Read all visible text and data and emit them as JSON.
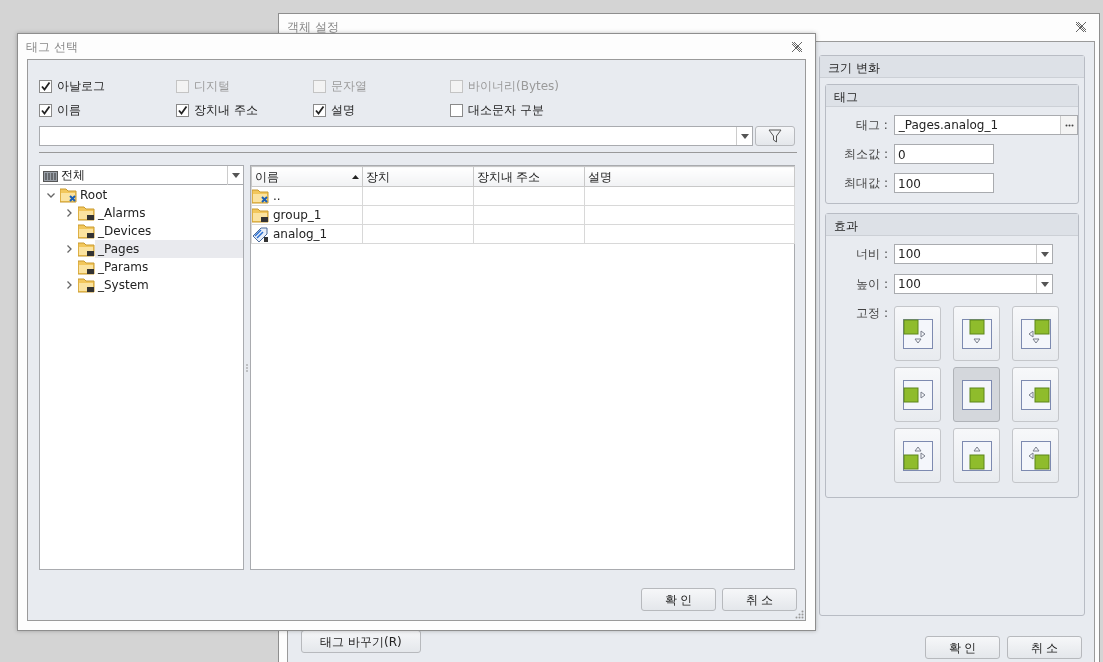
{
  "back_window": {
    "title": "객체 설정",
    "replace_button": "태그 바꾸기(R)",
    "panel_title": "크기 변화",
    "tag_group": {
      "title": "태그",
      "fields": [
        {
          "label": "태그 :",
          "value": "_Pages.analog_1",
          "kind": "browse"
        },
        {
          "label": "최소값 :",
          "value": "0",
          "kind": "text"
        },
        {
          "label": "최대값 :",
          "value": "100",
          "kind": "text"
        }
      ]
    },
    "effect_group": {
      "title": "효과",
      "fields": [
        {
          "label": "너비 :",
          "value": "100",
          "kind": "combo"
        },
        {
          "label": "높이 :",
          "value": "100",
          "kind": "combo"
        }
      ],
      "anchor_label": "고정 :",
      "anchors": [
        {
          "selected": false
        },
        {
          "selected": false
        },
        {
          "selected": false
        },
        {
          "selected": false
        },
        {
          "selected": true
        },
        {
          "selected": false
        },
        {
          "selected": false
        },
        {
          "selected": false
        },
        {
          "selected": false
        }
      ]
    },
    "buttons": [
      "확 인",
      "취 소"
    ]
  },
  "dialog": {
    "title": "태그 선택",
    "filters": [
      {
        "label": "아날로그",
        "checked": true,
        "disabled": false
      },
      {
        "label": "디지털",
        "checked": false,
        "disabled": true
      },
      {
        "label": "문자열",
        "checked": false,
        "disabled": true
      },
      {
        "label": "바이너리(Bytes)",
        "checked": false,
        "disabled": true
      },
      {
        "label": "이름",
        "checked": true,
        "disabled": false
      },
      {
        "label": "장치내 주소",
        "checked": true,
        "disabled": false
      },
      {
        "label": "설명",
        "checked": true,
        "disabled": false
      },
      {
        "label": "대소문자 구분",
        "checked": false,
        "disabled": false
      }
    ],
    "tree": {
      "scope": "전체",
      "items": [
        {
          "label": "Root",
          "kind": "root",
          "expanded": true,
          "selected": false,
          "children": [
            {
              "label": "_Alarms",
              "kind": "group",
              "expandable": true,
              "selected": false
            },
            {
              "label": "_Devices",
              "kind": "group",
              "expandable": false,
              "selected": false
            },
            {
              "label": "_Pages",
              "kind": "group",
              "expandable": true,
              "selected": true
            },
            {
              "label": "_Params",
              "kind": "group",
              "expandable": false,
              "selected": false
            },
            {
              "label": "_System",
              "kind": "group",
              "expandable": true,
              "selected": false
            }
          ]
        }
      ]
    },
    "table": {
      "columns": [
        {
          "label": "이름",
          "sorted": true
        },
        {
          "label": "장치",
          "sorted": false
        },
        {
          "label": "장치내 주소",
          "sorted": false
        },
        {
          "label": "설명",
          "sorted": false
        }
      ],
      "rows": [
        {
          "kind": "parent",
          "name": ".."
        },
        {
          "kind": "group",
          "name": "group_1"
        },
        {
          "kind": "tag",
          "name": "analog_1"
        }
      ]
    },
    "buttons": [
      "확 인",
      "취 소"
    ]
  }
}
